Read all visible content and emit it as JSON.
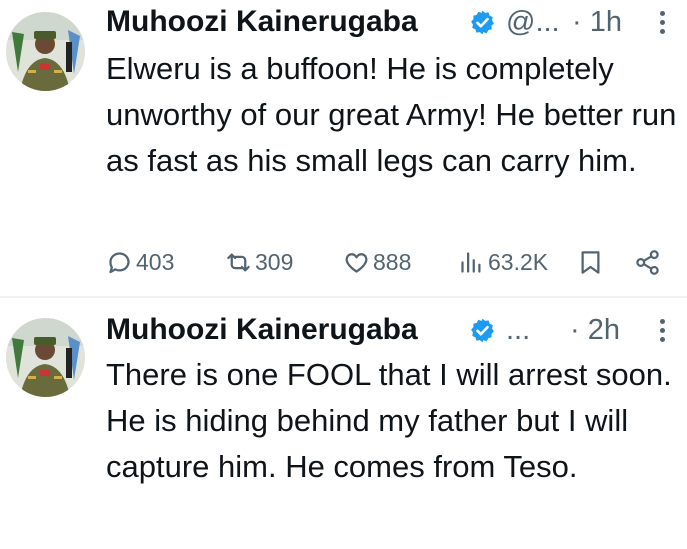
{
  "tweets": [
    {
      "author_name": "Muhoozi Kainerugaba",
      "handle": "@...",
      "time": "· 1h",
      "text": "Elweru is a buffoon! He is completely unworthy of our great Army! He better run as fast as his small legs can carry him.",
      "replies": "403",
      "reposts": "309",
      "likes": "888",
      "views": "63.2K"
    },
    {
      "author_name": "Muhoozi Kainerugaba",
      "handle": "...",
      "time": "· 2h",
      "text": "There is one FOOL that I will arrest soon. He is hiding behind my father but I will capture him. He comes from Teso."
    }
  ],
  "icons": {
    "verified": "verified-badge-icon",
    "more": "more-vertical-icon",
    "reply": "reply-icon",
    "repost": "repost-icon",
    "like": "heart-icon",
    "views": "views-chart-icon",
    "bookmark": "bookmark-icon",
    "share": "share-icon"
  },
  "colors": {
    "verified": "#1d9bf0",
    "secondary_text": "#536471",
    "primary_text": "#0f1419",
    "divider": "#eff3f4"
  }
}
